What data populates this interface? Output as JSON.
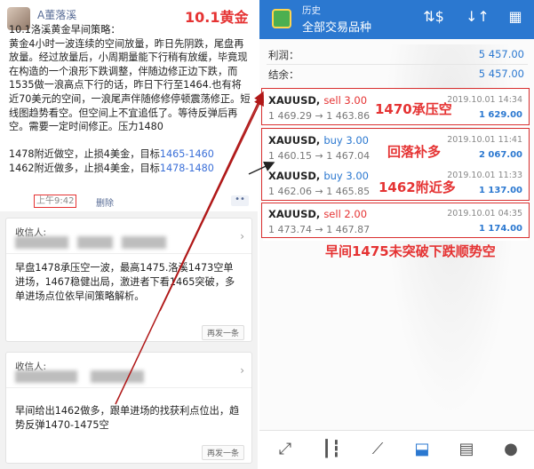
{
  "left": {
    "author": "A董落溪",
    "overlay_title": "10.1黄金",
    "post_text_main": "10.1洛溪黄金早间策略：\n黄金4小时一波连续的空间放量，昨日先阴跌，尾盘再放量。经过放量后，小周期量能下行稍有放缓，毕竟现在构造的一个浪形下跌调整，伴随边修正边下跌，而1535做一浪高点下行的话，昨日下行至1464.也有将近70美元的空间，一浪尾声伴随修修停顿震荡修正。短线图趋势看空。但空间上不宜追低了。等待反弹后再空。需要一定时间修正。压力1480\n\n1478附近做空，止损4美金，目标",
    "target_1": "1465-1460",
    "post_text_line2": "\n1462附近做多，止损4美金，目标",
    "target_2": "1478-1480",
    "time": "上午9:42",
    "delete_label": "删除",
    "more_label": "••",
    "card1": {
      "recipient_label": "收信人:",
      "body": "早盘1478承压空一波，最高1475.洛溪1473空单进场，1467稳健出局，激进者下看1465突破，多单进场点位依早间策略解析。",
      "resend": "再发一条"
    },
    "card2": {
      "recipient_label": "收信人:",
      "body": "早间给出1462做多，跟单进场的找获利点位出，趋势反弹1470-1475空",
      "resend": "再发一条"
    }
  },
  "right": {
    "title": "历史",
    "subtitle": "全部交易品种",
    "icons": [
      "dollar-exchange-icon",
      "sort-icon",
      "calendar-icon"
    ],
    "summary": [
      {
        "label": "利润：",
        "value": "5 457.00"
      },
      {
        "label": "结余：",
        "value": "5 457.00"
      }
    ],
    "orders": [
      {
        "symbol": "XAUUSD,",
        "side": "sell 3.00",
        "type": "sell",
        "prices": "1 469.29 → 1 463.86",
        "date": "2019.10.01 14:34",
        "profit": "1 629.00"
      },
      {
        "symbol": "XAUUSD,",
        "side": "buy 3.00",
        "type": "buy",
        "prices": "1 460.15 → 1 467.04",
        "date": "2019.10.01 11:41",
        "profit": "2 067.00"
      },
      {
        "symbol": "XAUUSD,",
        "side": "buy 3.00",
        "type": "buy",
        "prices": "1 462.06 → 1 465.85",
        "date": "2019.10.01 11:33",
        "profit": "1 137.00"
      },
      {
        "symbol": "XAUUSD,",
        "side": "sell 2.00",
        "type": "sell",
        "prices": "1 473.74 → 1 467.87",
        "date": "2019.10.01 04:35",
        "profit": "1 174.00"
      }
    ],
    "notes": {
      "n1": "1470承压空",
      "n2": "回落补多",
      "n3": "1462附近多",
      "n4": "早间1475未突破下跌顺势空"
    },
    "nav": [
      "trade-icon",
      "chart-candles-icon",
      "analytics-icon",
      "history-inbox-icon",
      "news-icon",
      "chat-icon"
    ]
  },
  "colors": {
    "accent": "#2b78d0",
    "annotation_red": "#e53333"
  }
}
